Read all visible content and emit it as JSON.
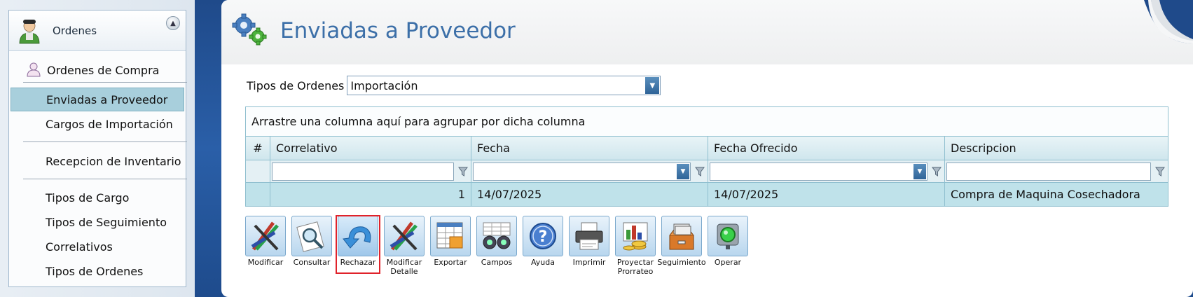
{
  "sidebar": {
    "header_title": "Ordenes",
    "items": [
      {
        "label": "Ordenes de Compra"
      },
      {
        "label": "Enviadas a Proveedor"
      },
      {
        "label": "Cargos de Importación"
      },
      {
        "label": "Recepcion de Inventario"
      },
      {
        "label": "Tipos de Cargo"
      },
      {
        "label": "Tipos de Seguimiento"
      },
      {
        "label": "Correlativos"
      },
      {
        "label": "Tipos de Ordenes"
      }
    ]
  },
  "main": {
    "title": "Enviadas a Proveedor",
    "filter_label": "Tipos de Ordenes",
    "filter_value": "Importación"
  },
  "grid": {
    "group_hint": "Arrastre una columna aquí para agrupar por dicha columna",
    "columns": [
      "#",
      "Correlativo",
      "Fecha",
      "Fecha Ofrecido",
      "Descripcion"
    ],
    "rows": [
      {
        "correlativo": "1",
        "fecha": "14/07/2025",
        "fecha_ofrecido": "14/07/2025",
        "descripcion": "Compra de Maquina Cosechadora"
      }
    ]
  },
  "toolbar": {
    "buttons": [
      {
        "label": "Modificar",
        "icon": "pencils-icon"
      },
      {
        "label": "Consultar",
        "icon": "magnifier-icon"
      },
      {
        "label": "Rechazar",
        "icon": "undo-arrow-icon"
      },
      {
        "label1": "Modificar",
        "label2": "Detalle",
        "icon": "pencils-icon"
      },
      {
        "label": "Exportar",
        "icon": "spreadsheet-icon"
      },
      {
        "label": "Campos",
        "icon": "binoculars-icon"
      },
      {
        "label": "Ayuda",
        "icon": "help-icon"
      },
      {
        "label": "Imprimir",
        "icon": "printer-icon"
      },
      {
        "label1": "Proyectar",
        "label2": "Prorrateo",
        "icon": "coins-chart-icon"
      },
      {
        "label": "Seguimiento",
        "icon": "card-file-icon"
      },
      {
        "label": "Operar",
        "icon": "traffic-light-icon"
      }
    ]
  },
  "colors": {
    "accent": "#3c6fa8",
    "highlight": "#e0222a",
    "row_selected": "#bfe2ea"
  }
}
